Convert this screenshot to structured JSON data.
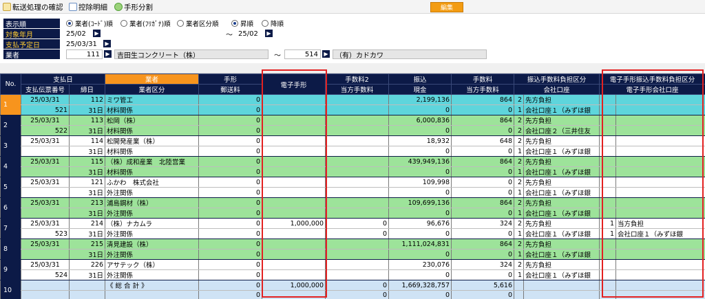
{
  "toolbar": {
    "transfer_confirm": "転送処理の確認",
    "deduction_details": "控除明細",
    "bill_split": "手形分割",
    "header_button": "編集"
  },
  "filters": {
    "order_label": "表示順",
    "sort_options": [
      "業者(ｺｰﾄﾞ)順",
      "業者(ﾌﾘｶﾞﾅ)順",
      "業者区分順"
    ],
    "sort_selected": 0,
    "direction_options": [
      "昇順",
      "降順"
    ],
    "direction_selected": 0,
    "target_month_label": "対象年月",
    "target_month_from": "25/02",
    "target_month_range_sep": "～",
    "target_month_to": "25/02",
    "payment_date_label": "支払予定日",
    "payment_date": "25/03/31",
    "vendor_label": "業者",
    "vendor_from_code": "111",
    "vendor_from_name": "吉田生コンクリート（株）",
    "vendor_range_sep": "～",
    "vendor_to_code": "514",
    "vendor_to_name": "（有）カドカワ"
  },
  "grid": {
    "headers_top": [
      "No.",
      "支払日",
      "業者",
      "手形",
      "電子手形",
      "手数料2",
      "振込",
      "手数料",
      "振込手数料負担区分",
      "電子手形振込手数料負担区分"
    ],
    "headers_bottom": [
      "支払伝票番号",
      "締日",
      "業者区分",
      "郵送料",
      "当方手数料",
      "現金",
      "当方手数料",
      "会社口座",
      "電子手形会社口座"
    ],
    "rows": [
      {
        "no": "1",
        "style": "cyan",
        "selected": true,
        "a": {
          "date": "25/03/31",
          "code": "112",
          "name": "ミワ管工",
          "bill": "0",
          "ebill": "",
          "fee2": "",
          "transfer": "2,199,136",
          "fee": "864",
          "burden_no": "2",
          "burden": "先方負担",
          "eb_no": "",
          "eb": ""
        },
        "b": {
          "slip": "521",
          "close": "31日",
          "category": "材料関係",
          "postage": "0",
          "ebill": "",
          "ourfee": "",
          "cash": "0",
          "ourfee2": "0",
          "acct_no": "1",
          "acct": "会社口座１（みずほ銀",
          "eacct_no": "",
          "eacct": ""
        }
      },
      {
        "no": "2",
        "style": "green",
        "selected": false,
        "a": {
          "date": "25/03/31",
          "code": "113",
          "name": "松岡（株）",
          "bill": "0",
          "ebill": "",
          "fee2": "",
          "transfer": "6,000,836",
          "fee": "864",
          "burden_no": "2",
          "burden": "先方負担",
          "eb_no": "",
          "eb": ""
        },
        "b": {
          "slip": "522",
          "close": "31日",
          "category": "材料関係",
          "postage": "0",
          "ebill": "",
          "ourfee": "",
          "cash": "0",
          "ourfee2": "0",
          "acct_no": "2",
          "acct": "会社口座２（三井住友",
          "eacct_no": "",
          "eacct": ""
        }
      },
      {
        "no": "3",
        "style": "white",
        "selected": false,
        "a": {
          "date": "25/03/31",
          "code": "114",
          "name": "松開発産業（株）",
          "bill": "0",
          "ebill": "",
          "fee2": "",
          "transfer": "18,932",
          "fee": "648",
          "burden_no": "2",
          "burden": "先方負担",
          "eb_no": "",
          "eb": ""
        },
        "b": {
          "slip": "",
          "close": "31日",
          "category": "材料関係",
          "postage": "0",
          "ebill": "",
          "ourfee": "",
          "cash": "0",
          "ourfee2": "0",
          "acct_no": "1",
          "acct": "会社口座１（みずほ銀",
          "eacct_no": "",
          "eacct": ""
        }
      },
      {
        "no": "4",
        "style": "green",
        "selected": false,
        "a": {
          "date": "25/03/31",
          "code": "115",
          "name": "（株）成和産業　北陸営業",
          "bill": "0",
          "ebill": "",
          "fee2": "",
          "transfer": "439,949,136",
          "fee": "864",
          "burden_no": "2",
          "burden": "先方負担",
          "eb_no": "",
          "eb": ""
        },
        "b": {
          "slip": "",
          "close": "31日",
          "category": "材料関係",
          "postage": "0",
          "ebill": "",
          "ourfee": "",
          "cash": "0",
          "ourfee2": "0",
          "acct_no": "1",
          "acct": "会社口座１（みずほ銀",
          "eacct_no": "",
          "eacct": ""
        }
      },
      {
        "no": "5",
        "style": "white",
        "selected": false,
        "a": {
          "date": "25/03/31",
          "code": "121",
          "name": "ふかわ　株式会社",
          "bill": "0",
          "ebill": "",
          "fee2": "",
          "transfer": "109,998",
          "fee": "0",
          "burden_no": "2",
          "burden": "先方負担",
          "eb_no": "",
          "eb": ""
        },
        "b": {
          "slip": "",
          "close": "31日",
          "category": "外注関係",
          "postage": "0",
          "ebill": "",
          "ourfee": "",
          "cash": "0",
          "ourfee2": "0",
          "acct_no": "1",
          "acct": "会社口座１（みずほ銀",
          "eacct_no": "",
          "eacct": ""
        }
      },
      {
        "no": "6",
        "style": "green",
        "selected": false,
        "a": {
          "date": "25/03/31",
          "code": "213",
          "name": "浦島鋼材（株）",
          "bill": "0",
          "ebill": "",
          "fee2": "",
          "transfer": "109,699,136",
          "fee": "864",
          "burden_no": "2",
          "burden": "先方負担",
          "eb_no": "",
          "eb": ""
        },
        "b": {
          "slip": "",
          "close": "31日",
          "category": "外注関係",
          "postage": "0",
          "ebill": "",
          "ourfee": "",
          "cash": "0",
          "ourfee2": "0",
          "acct_no": "1",
          "acct": "会社口座１（みずほ銀",
          "eacct_no": "",
          "eacct": ""
        }
      },
      {
        "no": "7",
        "style": "white",
        "selected": false,
        "a": {
          "date": "25/03/31",
          "code": "214",
          "name": "（株）ナカムラ",
          "bill": "0",
          "ebill": "1,000,000",
          "fee2": "0",
          "transfer": "96,676",
          "fee": "324",
          "burden_no": "2",
          "burden": "先方負担",
          "eb_no": "1",
          "eb": "当方負担"
        },
        "b": {
          "slip": "523",
          "close": "31日",
          "category": "外注関係",
          "postage": "0",
          "ebill": "",
          "ourfee": "0",
          "cash": "0",
          "ourfee2": "0",
          "acct_no": "1",
          "acct": "会社口座１（みずほ銀",
          "eacct_no": "1",
          "eacct": "会社口座１（みずほ銀"
        }
      },
      {
        "no": "8",
        "style": "green",
        "selected": false,
        "a": {
          "date": "25/03/31",
          "code": "215",
          "name": "清見建設（株）",
          "bill": "0",
          "ebill": "",
          "fee2": "",
          "transfer": "1,111,024,831",
          "fee": "864",
          "burden_no": "2",
          "burden": "先方負担",
          "eb_no": "",
          "eb": ""
        },
        "b": {
          "slip": "",
          "close": "31日",
          "category": "外注関係",
          "postage": "0",
          "ebill": "",
          "ourfee": "",
          "cash": "0",
          "ourfee2": "0",
          "acct_no": "1",
          "acct": "会社口座１（みずほ銀",
          "eacct_no": "",
          "eacct": ""
        }
      },
      {
        "no": "9",
        "style": "white",
        "selected": false,
        "a": {
          "date": "25/03/31",
          "code": "226",
          "name": "アサテック（株）",
          "bill": "0",
          "ebill": "",
          "fee2": "",
          "transfer": "230,076",
          "fee": "324",
          "burden_no": "2",
          "burden": "先方負担",
          "eb_no": "",
          "eb": ""
        },
        "b": {
          "slip": "524",
          "close": "31日",
          "category": "外注関係",
          "postage": "0",
          "ebill": "",
          "ourfee": "",
          "cash": "0",
          "ourfee2": "0",
          "acct_no": "1",
          "acct": "会社口座１（みずほ銀",
          "eacct_no": "",
          "eacct": ""
        }
      },
      {
        "no": "10",
        "style": "blue",
        "selected": false,
        "a": {
          "date": "",
          "code": "",
          "name": "《 総 合 計 》",
          "bill": "0",
          "ebill": "1,000,000",
          "fee2": "0",
          "transfer": "1,669,328,757",
          "fee": "5,616",
          "burden_no": "",
          "burden": "",
          "eb_no": "",
          "eb": ""
        },
        "b": {
          "slip": "",
          "close": "",
          "category": "",
          "postage": "0",
          "ebill": "",
          "ourfee": "0",
          "cash": "0",
          "ourfee2": "0",
          "acct_no": "",
          "acct": "",
          "eacct_no": "",
          "eacct": ""
        }
      }
    ]
  },
  "colors": {
    "nav": "#0c1a47",
    "accent": "#f7941d",
    "row_selected": "#5ed5dc",
    "row_green": "#9de39a",
    "row_total": "#cfe3f5",
    "highlight": "#e32020"
  }
}
